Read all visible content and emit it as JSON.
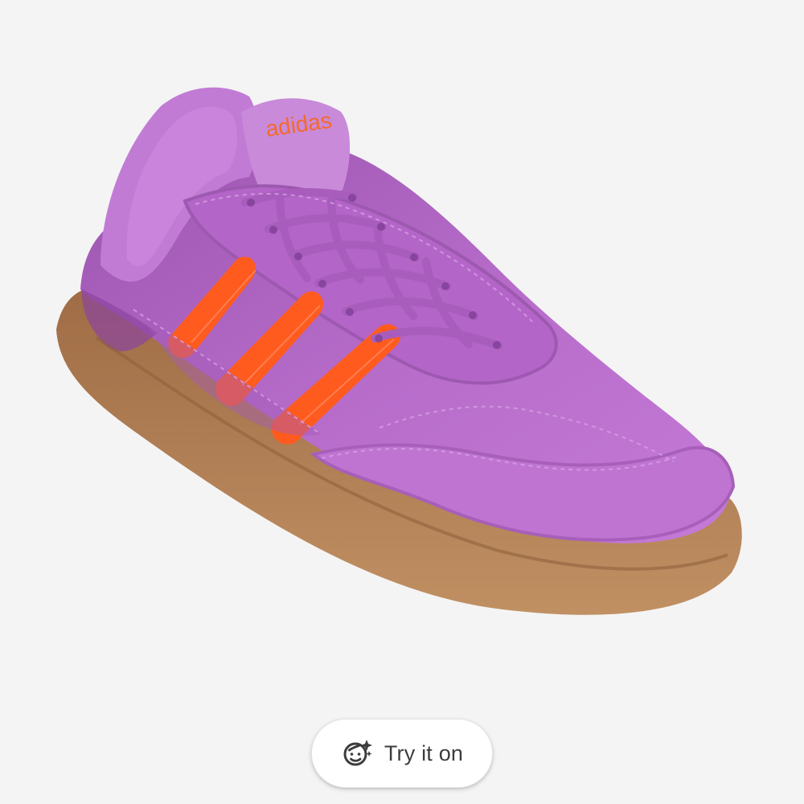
{
  "product": {
    "brand_text": "adidas",
    "colors": {
      "upper": "#b56ac8",
      "upper_dark": "#8d46a1",
      "stripes": "#ff5a1f",
      "sole": "#a8764a",
      "background": "#f4f4f4"
    }
  },
  "actions": {
    "try_on_label": "Try it on",
    "try_on_icon": "face-sparkle-icon"
  }
}
